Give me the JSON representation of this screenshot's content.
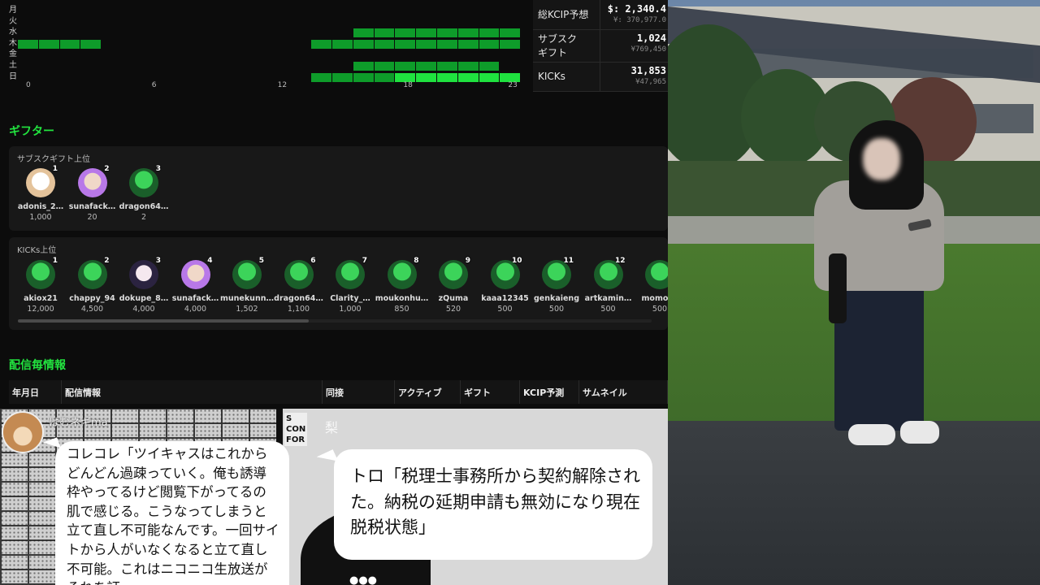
{
  "heatmap": {
    "days": [
      "月",
      "火",
      "水",
      "木",
      "金",
      "土",
      "日"
    ],
    "hour_ticks": [
      "0",
      "6",
      "12",
      "18",
      "23"
    ],
    "active": [
      {
        "day": 2,
        "from": 16,
        "to": 23,
        "level": "normal"
      },
      {
        "day": 3,
        "from": 0,
        "to": 3,
        "level": "normal"
      },
      {
        "day": 3,
        "from": 14,
        "to": 23,
        "level": "normal"
      },
      {
        "day": 5,
        "from": 16,
        "to": 22,
        "level": "normal"
      },
      {
        "day": 6,
        "from": 14,
        "to": 17,
        "level": "normal"
      },
      {
        "day": 6,
        "from": 18,
        "to": 23,
        "level": "bright"
      }
    ]
  },
  "kcip": {
    "rows": [
      {
        "label": "総KCIP予想",
        "main": "$: 2,340.4",
        "sub": "¥: 370,977.0"
      },
      {
        "label": "サブスク\nギフト",
        "main": "1,024",
        "sub": "¥769,450"
      },
      {
        "label": "KICKs",
        "main": "31,853",
        "sub": "¥47,965"
      }
    ]
  },
  "gifters": {
    "section_title": "ギフター",
    "subs_title": "サブスクギフト上位",
    "subs": [
      {
        "rank": "1",
        "name": "adonis_2…",
        "amount": "1,000",
        "avatar": "cream"
      },
      {
        "rank": "2",
        "name": "sunafack…",
        "amount": "20",
        "avatar": "purple"
      },
      {
        "rank": "3",
        "name": "dragon64…",
        "amount": "2",
        "avatar": "green"
      }
    ],
    "kicks_title": "KICKs上位",
    "kicks": [
      {
        "rank": "1",
        "name": "akiox21",
        "amount": "12,000",
        "avatar": "green"
      },
      {
        "rank": "2",
        "name": "chappy_94",
        "amount": "4,500",
        "avatar": "green"
      },
      {
        "rank": "3",
        "name": "dokupe_8…",
        "amount": "4,000",
        "avatar": "anime"
      },
      {
        "rank": "4",
        "name": "sunafack…",
        "amount": "4,000",
        "avatar": "purple"
      },
      {
        "rank": "5",
        "name": "munekunn…",
        "amount": "1,502",
        "avatar": "green"
      },
      {
        "rank": "6",
        "name": "dragon64…",
        "amount": "1,100",
        "avatar": "green"
      },
      {
        "rank": "7",
        "name": "Clarity_…",
        "amount": "1,000",
        "avatar": "green"
      },
      {
        "rank": "8",
        "name": "moukonhu…",
        "amount": "850",
        "avatar": "green"
      },
      {
        "rank": "9",
        "name": "zQuma",
        "amount": "520",
        "avatar": "green"
      },
      {
        "rank": "10",
        "name": "kaaa12345",
        "amount": "500",
        "avatar": "green"
      },
      {
        "rank": "11",
        "name": "genkaieng",
        "amount": "500",
        "avatar": "green"
      },
      {
        "rank": "12",
        "name": "artkamin…",
        "amount": "500",
        "avatar": "green"
      },
      {
        "rank": "",
        "name": "momose",
        "amount": "500",
        "avatar": "green"
      }
    ]
  },
  "streams": {
    "section_title": "配信毎情報",
    "headers": [
      "年月日",
      "配信情報",
      "同接",
      "アクティブ",
      "ギフト",
      "KCIP予測",
      "サムネイル"
    ]
  },
  "comic": {
    "speaker_left": "はむネギma",
    "bubble_left": "コレコレ「ツイキャスはこれからどんどん過疎っていく。俺も誘導枠やってるけど閲覧下がってるの肌で感じる。こうなってしまうと立て直し不可能なんです。一回サイトから人がいなくなると立て直し不可能。これはニコニコ生放送がそれを証",
    "bubble_right": "トロ「税理士事務所から契約解除された。納税の延期申請も無効になり現在脱税状態」",
    "sign_text": "S\nCON\nFOR",
    "corner_text": "梨"
  },
  "colors": {
    "accent_green": "#22e33f",
    "heat_normal": "#0e9c2a",
    "heat_bright": "#1fe23f"
  }
}
